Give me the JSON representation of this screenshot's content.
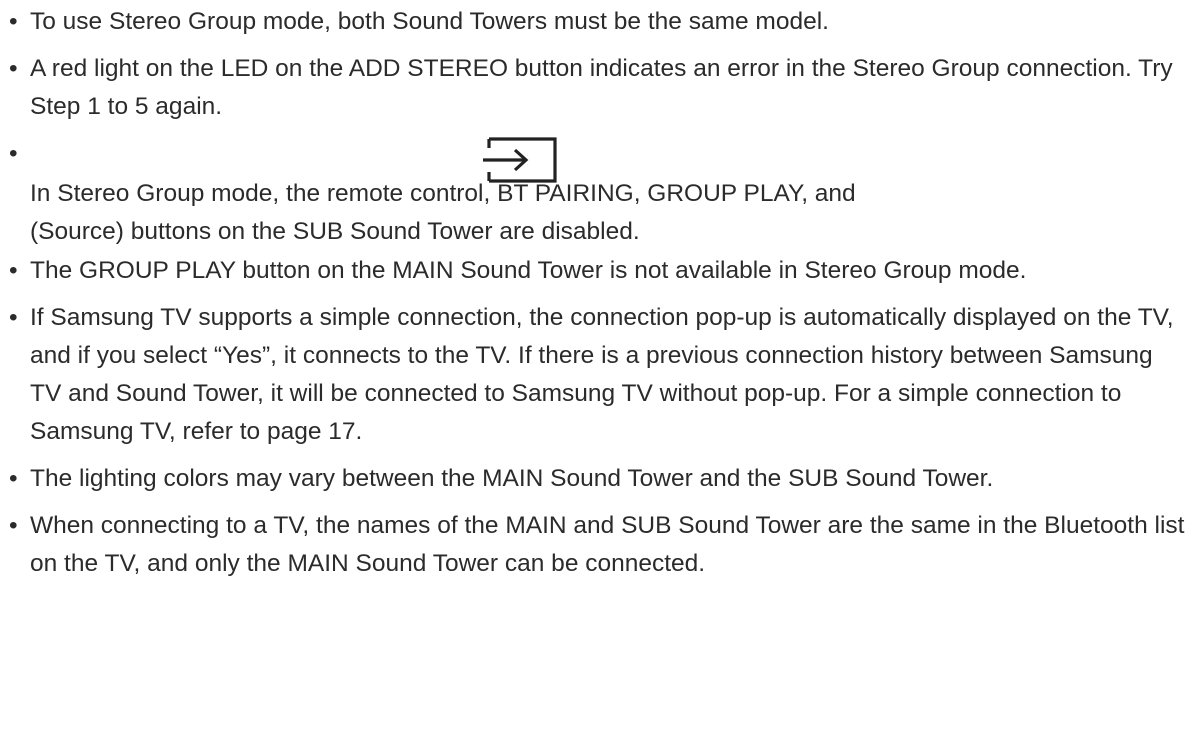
{
  "notes": [
    {
      "text": "To use Stereo Group mode, both Sound Towers must be the same model."
    },
    {
      "text": "A red light on the LED on the ADD STEREO button indicates an error in the Stereo Group connection. Try Step 1 to 5 again."
    },
    {
      "line1": "In Stereo Group mode, the remote control, BT PAIRING, GROUP PLAY, and",
      "line2": "(Source) buttons on the SUB Sound Tower are disabled.",
      "icon": "source-icon"
    },
    {
      "text": "The GROUP PLAY button on the MAIN Sound Tower is not available in Stereo Group mode."
    },
    {
      "text": "If Samsung TV supports a simple connection, the connection pop-up is automatically displayed on the TV, and if you select “Yes”, it connects to the TV. If there is a previous connection history between Samsung TV and Sound Tower, it will be connected to Samsung TV without pop-up. For a simple connection to Samsung TV, refer to page 17."
    },
    {
      "text": "The lighting colors may vary between the MAIN Sound Tower and the SUB Sound Tower."
    },
    {
      "text": "When connecting to a TV, the names of the MAIN and SUB Sound Tower are the same in the Bluetooth list on the TV, and only the MAIN Sound Tower can be connected."
    }
  ],
  "bullet_char": "•",
  "text_color": "#2b2b2b"
}
